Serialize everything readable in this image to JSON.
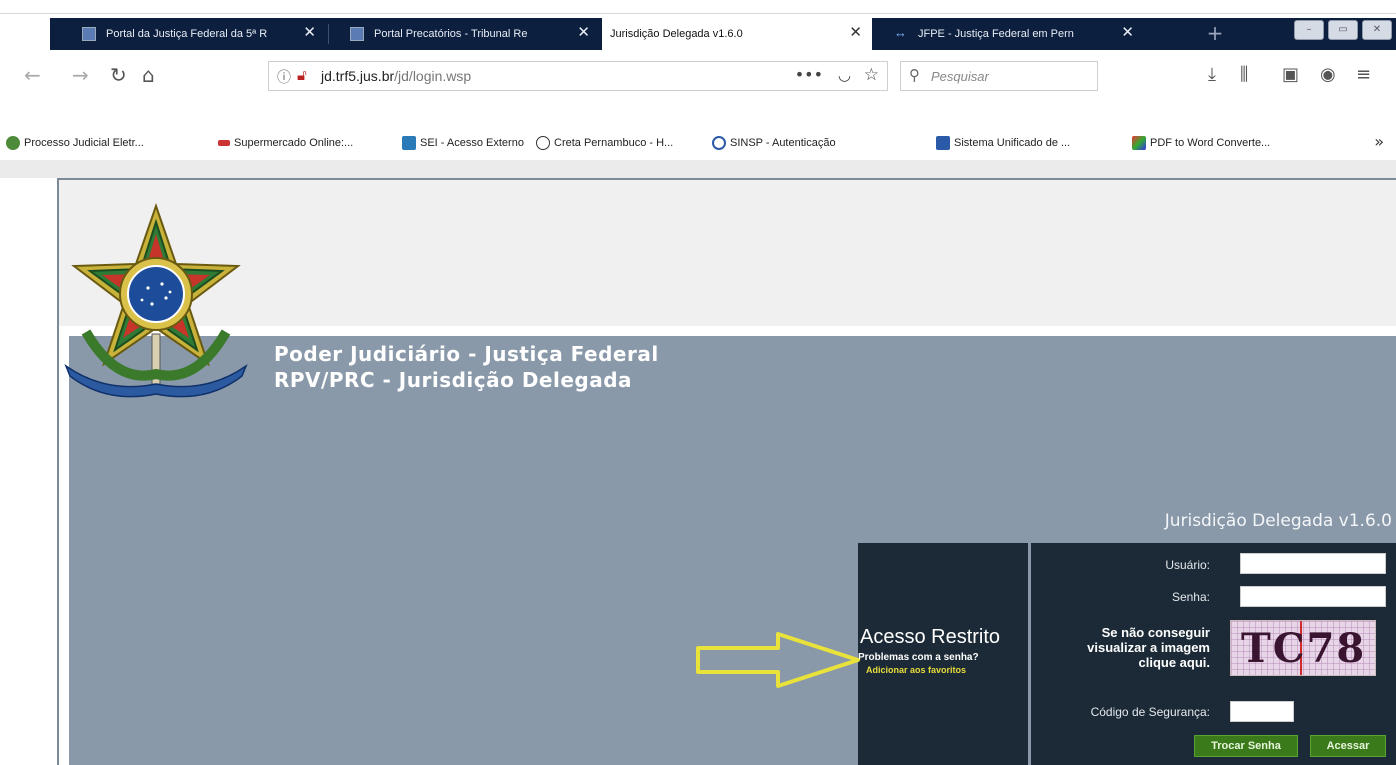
{
  "browser": {
    "tabs": [
      {
        "label": "Portal da Justiça Federal da 5ª R",
        "active": false
      },
      {
        "label": "Portal Precatórios - Tribunal Re",
        "active": false
      },
      {
        "label": "Jurisdição Delegada v1.6.0",
        "active": true
      },
      {
        "label": "JFPE - Justiça Federal em Pern",
        "active": false
      }
    ],
    "url": {
      "host": "jd.trf5.jus.br",
      "path": "/jd/login.wsp"
    },
    "search_placeholder": "Pesquisar",
    "bookmarks": [
      "Processo Judicial Eletr...",
      "Supermercado Online:...",
      "SEI - Acesso Externo",
      "Creta Pernambuco - H...",
      "SINSP - Autenticação",
      "Sistema Unificado de ...",
      "PDF to Word Converte..."
    ]
  },
  "page": {
    "title_line1": "Poder Judiciário - Justiça Federal",
    "title_line2": "RPV/PRC - Jurisdição Delegada",
    "version": "Jurisdição Delegada v1.6.0"
  },
  "login": {
    "heading": "Acesso Restrito",
    "problems_link": "Problemas com a senha?",
    "favorites_link": "Adicionar aos favoritos",
    "user_label": "Usuário:",
    "password_label": "Senha:",
    "captcha_note": "Se não conseguir visualizar a imagem clique aqui.",
    "captcha_text": "TC78",
    "security_code_label": "Código de Segurança:",
    "change_password_button": "Trocar Senha",
    "access_button": "Acessar"
  },
  "colors": {
    "tabbar": "#0c1f3f",
    "main_band": "#8999a9",
    "login_panel": "#1b2a36",
    "button_green": "#3b7a1a",
    "arrow_yellow": "#e8e23a"
  }
}
